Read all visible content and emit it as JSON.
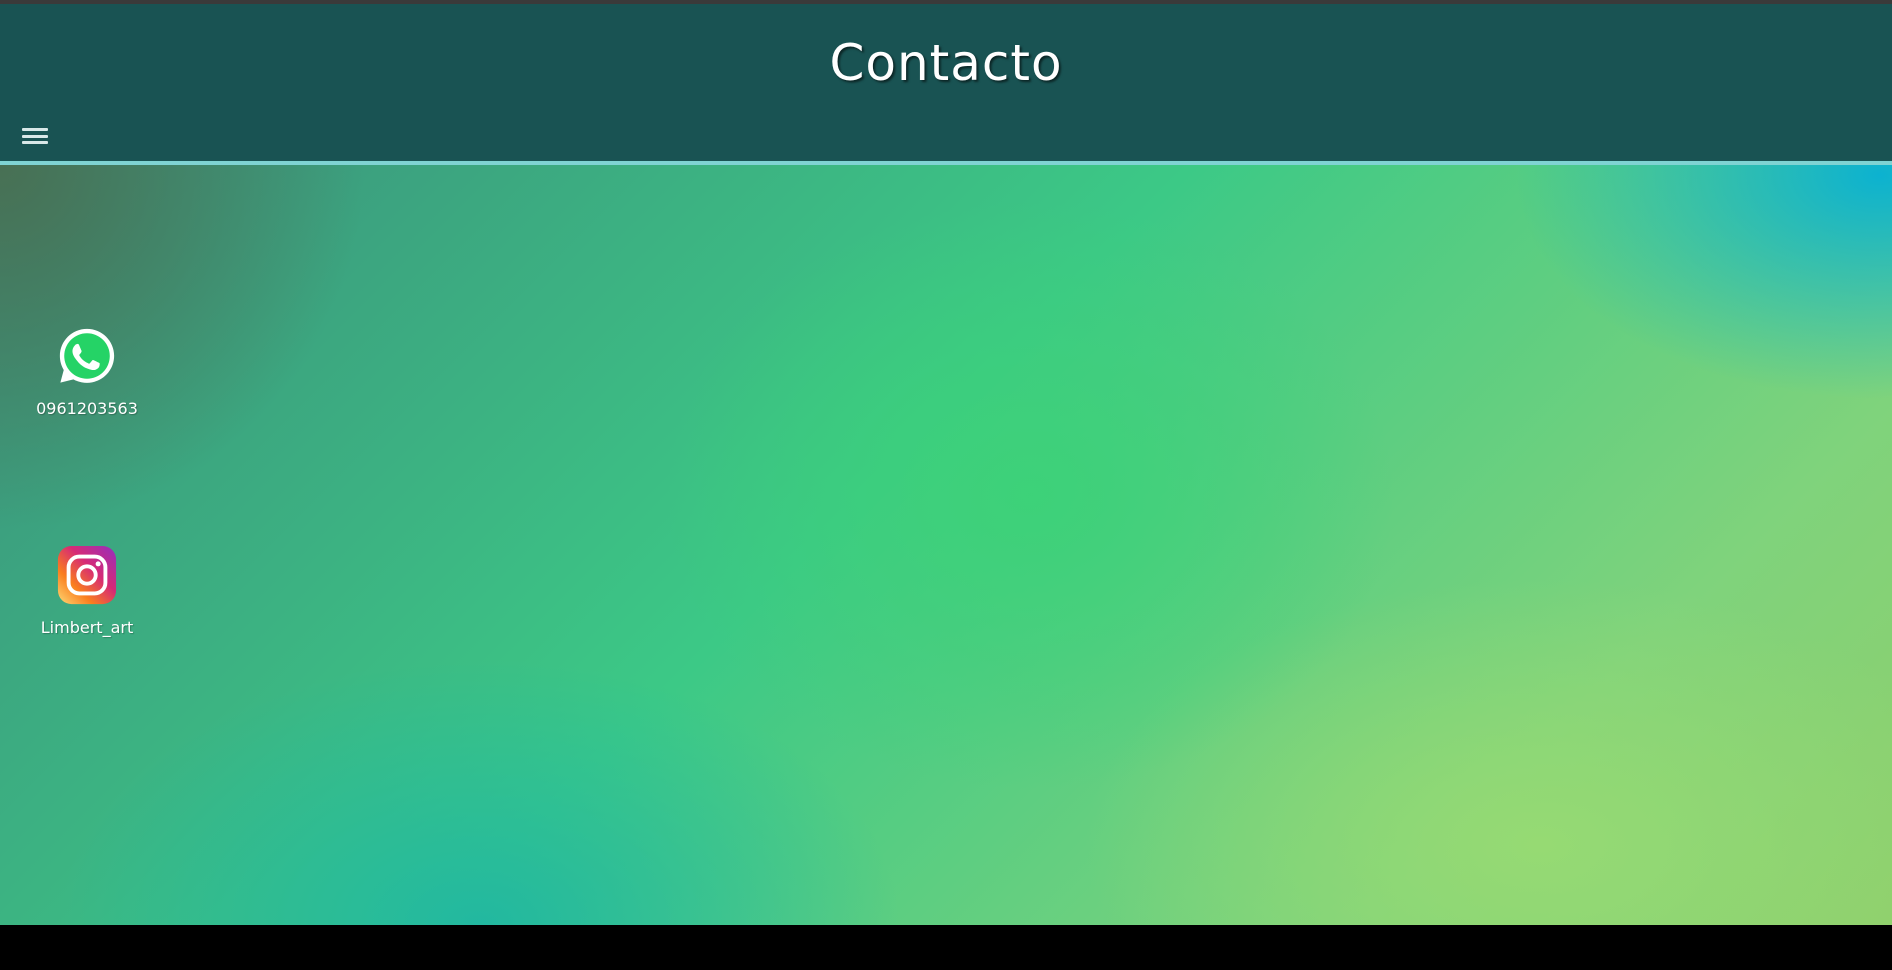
{
  "header": {
    "title": "Contacto",
    "menu_icon": "hamburger-menu-icon",
    "background_color": "#195353",
    "rule_color": "#7fd3d3"
  },
  "contacts": [
    {
      "icon": "whatsapp-icon",
      "label": "0961203563",
      "icon_color": "#25d366"
    },
    {
      "icon": "instagram-icon",
      "label": "Limbert_art",
      "icon_color": "#e1306c"
    }
  ]
}
